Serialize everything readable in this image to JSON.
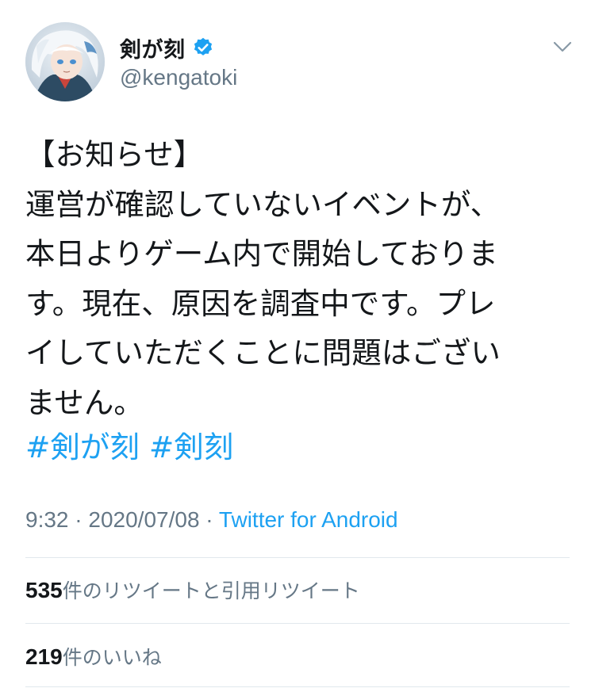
{
  "user": {
    "display_name": "剣が刻",
    "handle": "@kengatoki",
    "verified_icon": "verified-badge-icon",
    "avatar": "avatar-image"
  },
  "menu": {
    "icon": "chevron-down-icon"
  },
  "tweet": {
    "text": "【お知らせ】\n運営が確認していないイベントが、\n本日よりゲーム内で開始しておりま\nす。現在、原因を調査中です。プレ\nイしていただくことに問題はござい\nません。",
    "hashtags": [
      "#剣が刻",
      "#剣刻"
    ]
  },
  "meta": {
    "time": "9:32",
    "separator": " · ",
    "date": "2020/07/08",
    "source": "Twitter for Android"
  },
  "stats": {
    "retweets": {
      "count": "535",
      "label": "件のリツイートと引用リツイート"
    },
    "likes": {
      "count": "219",
      "label": "件のいいね"
    }
  },
  "colors": {
    "link": "#1da1f2",
    "text": "#14171a",
    "secondary": "#657786",
    "divider": "#e1e8ed"
  }
}
